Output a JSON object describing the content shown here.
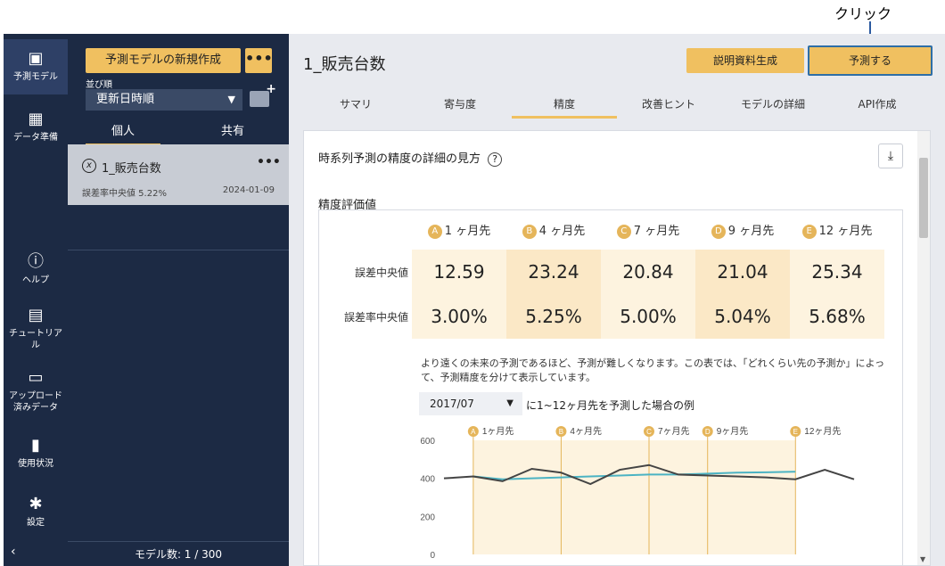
{
  "annotation": {
    "label": "クリック"
  },
  "nav": {
    "items": [
      {
        "label": "予測モデル"
      },
      {
        "label": "データ準備"
      },
      {
        "label": "ヘルプ"
      },
      {
        "label": "チュートリアル"
      },
      {
        "label": "アップロード済みデータ"
      },
      {
        "label": "使用状況"
      },
      {
        "label": "設定"
      }
    ],
    "collapse": "‹"
  },
  "panel": {
    "new_button": "予測モデルの新規作成",
    "more": "•••",
    "sort_label": "並び順",
    "sort_value": "更新日時順",
    "tabs": [
      "個人",
      "共有"
    ],
    "item": {
      "title": "1_販売台数",
      "more": "•••",
      "meta": "誤差率中央値 5.22%",
      "date": "2024-01-09"
    },
    "footer": "モデル数: 1 / 300"
  },
  "main": {
    "title": "1_販売台数",
    "doc_button": "説明資料生成",
    "predict_button": "予測する",
    "tabs": [
      "サマリ",
      "寄与度",
      "精度",
      "改善ヒント",
      "モデルの詳細",
      "API作成"
    ],
    "active_tab": "精度",
    "heading": "時系列予測の精度の詳細の見方",
    "help": "?",
    "download": "⤓",
    "section_title": "精度評価値",
    "columns": [
      {
        "badge": "A",
        "label": "1 ヶ月先"
      },
      {
        "badge": "B",
        "label": "4 ヶ月先"
      },
      {
        "badge": "C",
        "label": "7 ヶ月先"
      },
      {
        "badge": "D",
        "label": "9 ヶ月先"
      },
      {
        "badge": "E",
        "label": "12 ヶ月先"
      }
    ],
    "rows": [
      {
        "label": "誤差中央値",
        "values": [
          "12.59",
          "23.24",
          "20.84",
          "21.04",
          "25.34"
        ]
      },
      {
        "label": "誤差率中央値",
        "values": [
          "3.00%",
          "5.25%",
          "5.00%",
          "5.04%",
          "5.68%"
        ]
      }
    ],
    "note": "より遠くの未来の予測であるほど、予測が難しくなります。この表では、「どれくらい先の予測か」によって、予測精度を分けて表示しています。",
    "month_select": "2017/07",
    "month_suffix": "に1~12ヶ月先を予測した場合の例"
  },
  "chart_data": {
    "type": "line",
    "ylim": [
      0,
      600
    ],
    "yticks": [
      "600",
      "400",
      "200",
      "0"
    ],
    "markers": [
      {
        "badge": "A",
        "label": "1ヶ月先",
        "x": 1
      },
      {
        "badge": "B",
        "label": "4ヶ月先",
        "x": 4
      },
      {
        "badge": "C",
        "label": "7ヶ月先",
        "x": 7
      },
      {
        "badge": "D",
        "label": "9ヶ月先",
        "x": 9
      },
      {
        "badge": "E",
        "label": "12ヶ月先",
        "x": 12
      }
    ],
    "actual": [
      400,
      410,
      385,
      450,
      430,
      370,
      445,
      470,
      420,
      415,
      410,
      405,
      395,
      445,
      395
    ],
    "predicted": [
      null,
      410,
      395,
      400,
      405,
      410,
      415,
      420,
      420,
      425,
      430,
      432,
      435
    ],
    "colors": {
      "actual": "#444444",
      "predicted": "#4bb3c3",
      "band": "#fdf3df",
      "marker": "#e5b55a"
    }
  }
}
